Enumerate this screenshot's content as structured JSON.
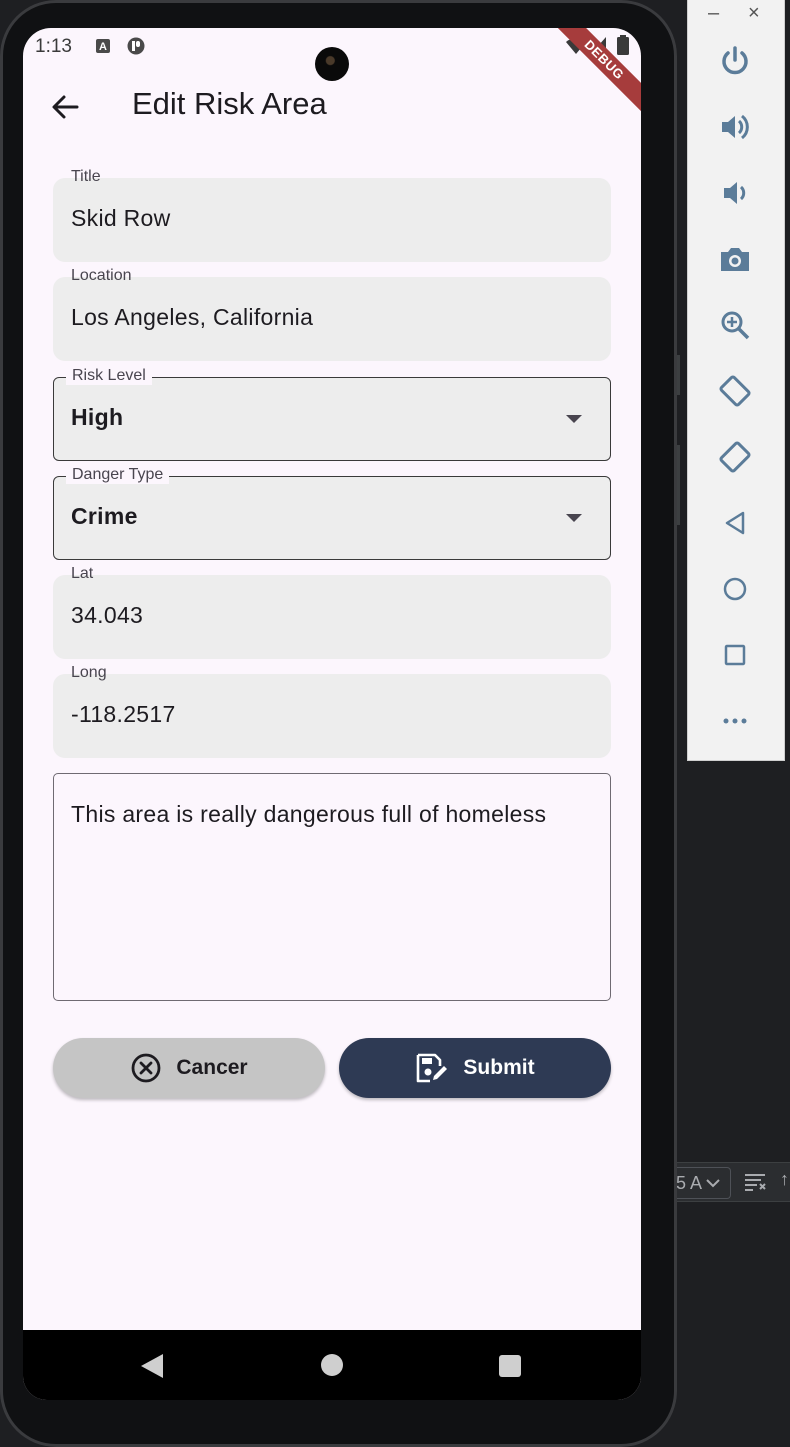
{
  "status_bar": {
    "time": "1:13",
    "debug_label": "DEBUG"
  },
  "app_bar": {
    "title": "Edit Risk Area"
  },
  "form": {
    "title": {
      "label": "Title",
      "value": "Skid Row"
    },
    "location": {
      "label": "Location",
      "value": "Los Angeles, California"
    },
    "risk_level": {
      "label": "Risk Level",
      "value": "High"
    },
    "danger_type": {
      "label": "Danger Type",
      "value": "Crime"
    },
    "lat": {
      "label": "Lat",
      "value": "34.043"
    },
    "long": {
      "label": "Long",
      "value": "-118.2517"
    },
    "description": {
      "value": "This area is really dangerous full of homeless"
    }
  },
  "buttons": {
    "cancel": "Cancer",
    "submit": "Submit"
  },
  "ide": {
    "combo_text": "5 A"
  },
  "colors": {
    "screen_bg": "#fcf6fd",
    "field_bg": "#ededed",
    "submit_bg": "#2e3a54",
    "cancel_bg": "#c5c5c5",
    "debug_banner": "#a63c3c"
  }
}
